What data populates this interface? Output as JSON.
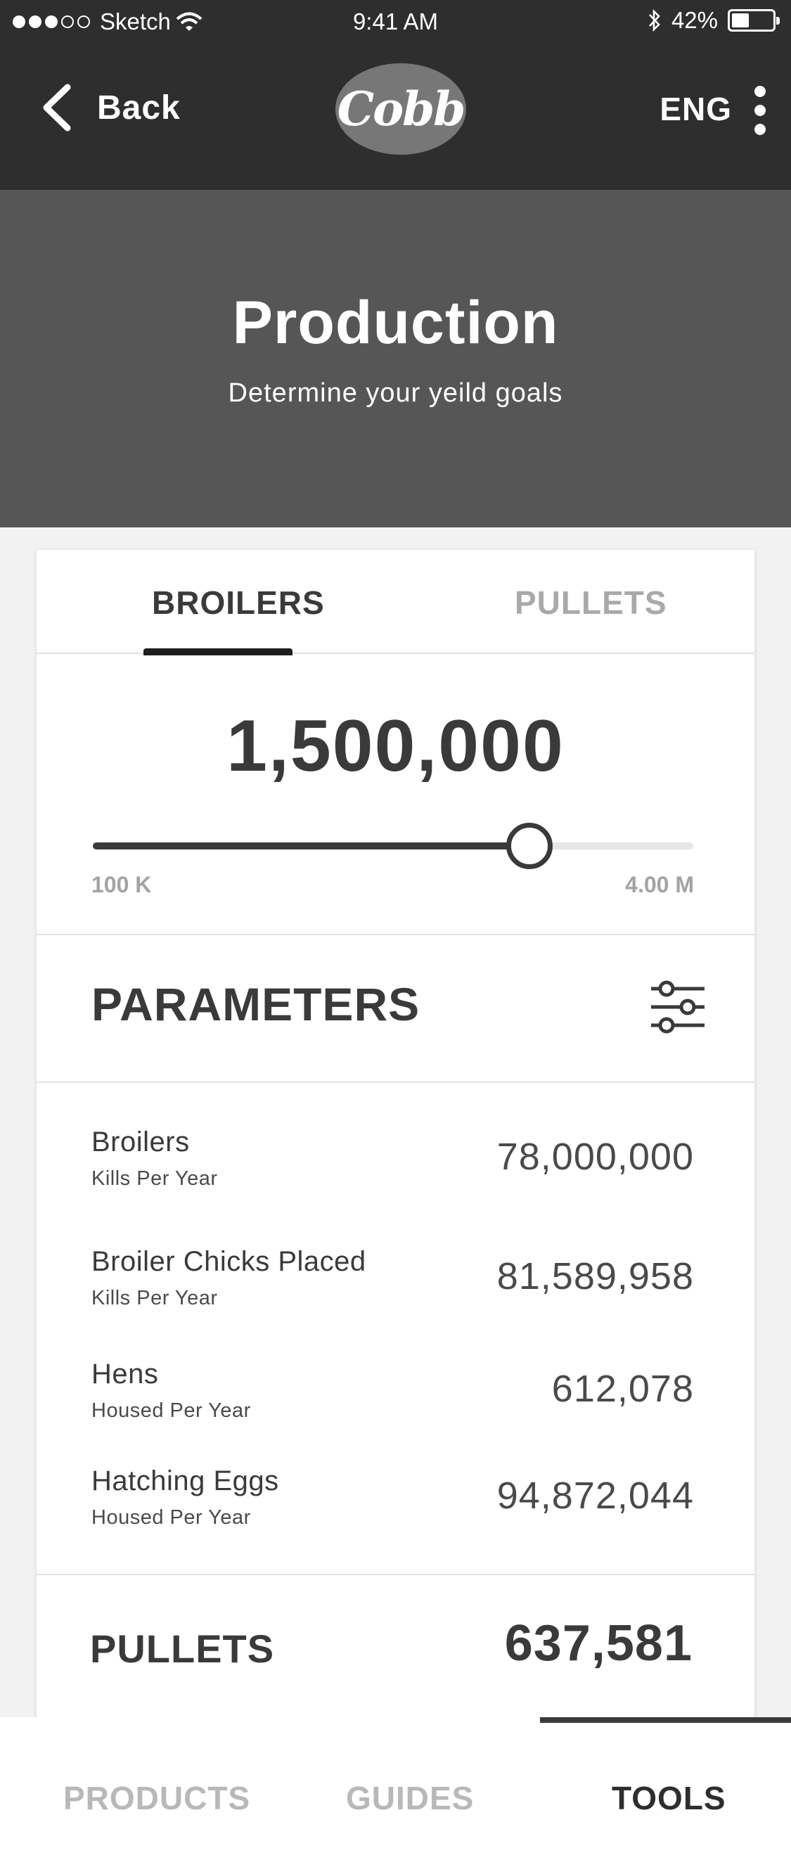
{
  "status_bar": {
    "carrier": "Sketch",
    "time": "9:41 AM",
    "battery": "42%",
    "battery_level": 0.42
  },
  "nav": {
    "back_label": "Back",
    "logo_text": "Cobb",
    "language": "ENG"
  },
  "hero": {
    "title": "Production",
    "subtitle": "Determine your yeild goals"
  },
  "tabs": [
    {
      "label": "BROILERS",
      "active": true
    },
    {
      "label": "PULLETS",
      "active": false
    }
  ],
  "slider": {
    "value_text": "1,500,000",
    "min_label": "100 K",
    "max_label": "4.00 M",
    "value": 1500000,
    "min": 100000,
    "max": 4000000,
    "position_fraction": 0.727
  },
  "parameters": {
    "title": "PARAMETERS",
    "rows": [
      {
        "label": "Broilers",
        "sub": "Kills Per Year",
        "value": "78,000,000"
      },
      {
        "label": "Broiler Chicks Placed",
        "sub": "Kills Per Year",
        "value": "81,589,958"
      },
      {
        "label": "Hens",
        "sub": "Housed Per Year",
        "value": "612,078"
      },
      {
        "label": "Hatching Eggs",
        "sub": "Housed Per Year",
        "value": "94,872,044"
      }
    ]
  },
  "pullets": {
    "label": "PULLETS",
    "value": "637,581"
  },
  "bottom_tabs": [
    {
      "label": "PRODUCTS",
      "active": false
    },
    {
      "label": "GUIDES",
      "active": false
    },
    {
      "label": "TOOLS",
      "active": true
    }
  ],
  "icons": {
    "back": "chevron-left-icon",
    "menu": "more-vertical-icon",
    "filter": "sliders-icon",
    "wifi": "wifi-icon",
    "bluetooth": "bluetooth-icon",
    "battery": "battery-icon"
  }
}
